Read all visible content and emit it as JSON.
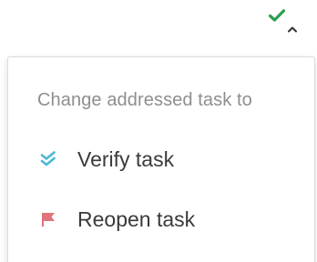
{
  "trigger": {
    "status_icon": "check-icon",
    "status_color": "#2e9e4f",
    "caret_icon": "caret-up-icon"
  },
  "dropdown": {
    "heading": "Change addressed task to",
    "items": [
      {
        "label": "Verify task",
        "icon": "double-check-icon",
        "icon_color": "#4cb8d4"
      },
      {
        "label": "Reopen task",
        "icon": "flag-icon",
        "icon_color": "#e0737b"
      }
    ]
  }
}
